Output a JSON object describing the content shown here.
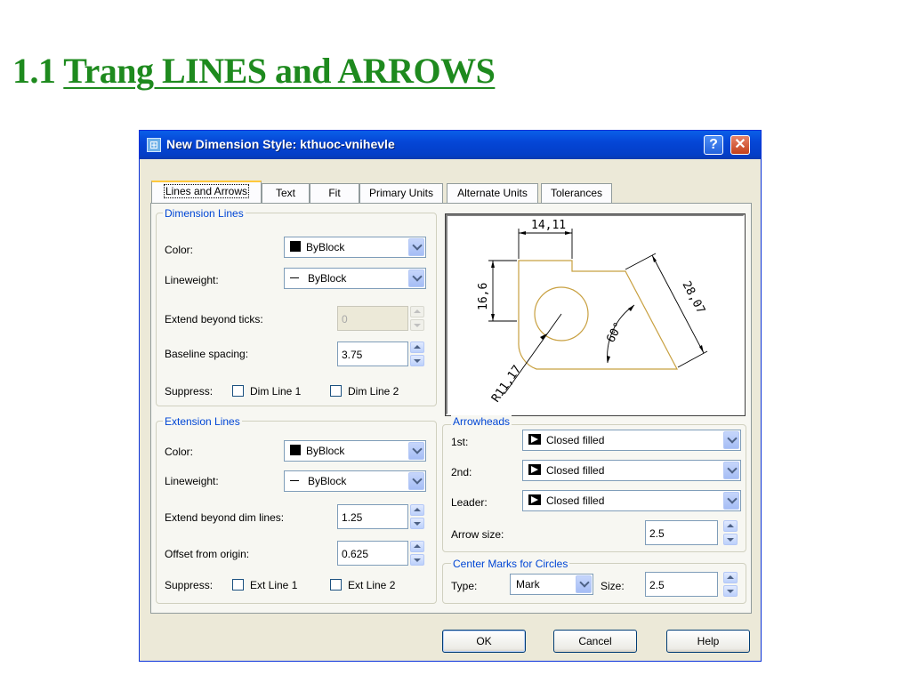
{
  "slide": {
    "title_prefix": "1.1 ",
    "title_underlined": "Trang LINES and ARROWS"
  },
  "dialog": {
    "title": "New Dimension Style: kthuoc-vnihevle",
    "help_btn": "?",
    "close_btn": "✕",
    "tabs": [
      "Lines and Arrows",
      "Text",
      "Fit",
      "Primary Units",
      "Alternate Units",
      "Tolerances"
    ],
    "dimension_lines": {
      "label": "Dimension Lines",
      "color_label": "Color:",
      "color_value": "ByBlock",
      "lineweight_label": "Lineweight:",
      "lineweight_value": "ByBlock",
      "extend_label": "Extend beyond ticks:",
      "extend_value": "0",
      "baseline_label": "Baseline spacing:",
      "baseline_value": "3.75",
      "suppress_label": "Suppress:",
      "dim1_label": "Dim Line 1",
      "dim2_label": "Dim Line 2"
    },
    "extension_lines": {
      "label": "Extension Lines",
      "color_label": "Color:",
      "color_value": "ByBlock",
      "lineweight_label": "Lineweight:",
      "lineweight_value": "ByBlock",
      "extend_label": "Extend beyond dim lines:",
      "extend_value": "1.25",
      "offset_label": "Offset from origin:",
      "offset_value": "0.625",
      "suppress_label": "Suppress:",
      "ext1_label": "Ext Line 1",
      "ext2_label": "Ext Line 2"
    },
    "preview": {
      "dim_top": "14,11",
      "dim_left": "16,6",
      "dim_diag": "28,07",
      "dim_angle": "60°",
      "dim_radius": "R11,17"
    },
    "arrowheads": {
      "label": "Arrowheads",
      "first_label": "1st:",
      "first_value": "Closed filled",
      "second_label": "2nd:",
      "second_value": "Closed filled",
      "leader_label": "Leader:",
      "leader_value": "Closed filled",
      "size_label": "Arrow size:",
      "size_value": "2.5"
    },
    "center_marks": {
      "label": "Center Marks for Circles",
      "type_label": "Type:",
      "type_value": "Mark",
      "size_label": "Size:",
      "size_value": "2.5"
    },
    "buttons": {
      "ok": "OK",
      "cancel": "Cancel",
      "help": "Help"
    },
    "colors": {
      "titlebar": "#0546d6",
      "group_label": "#0046d5",
      "preview_geometry": "#c8a040"
    }
  }
}
